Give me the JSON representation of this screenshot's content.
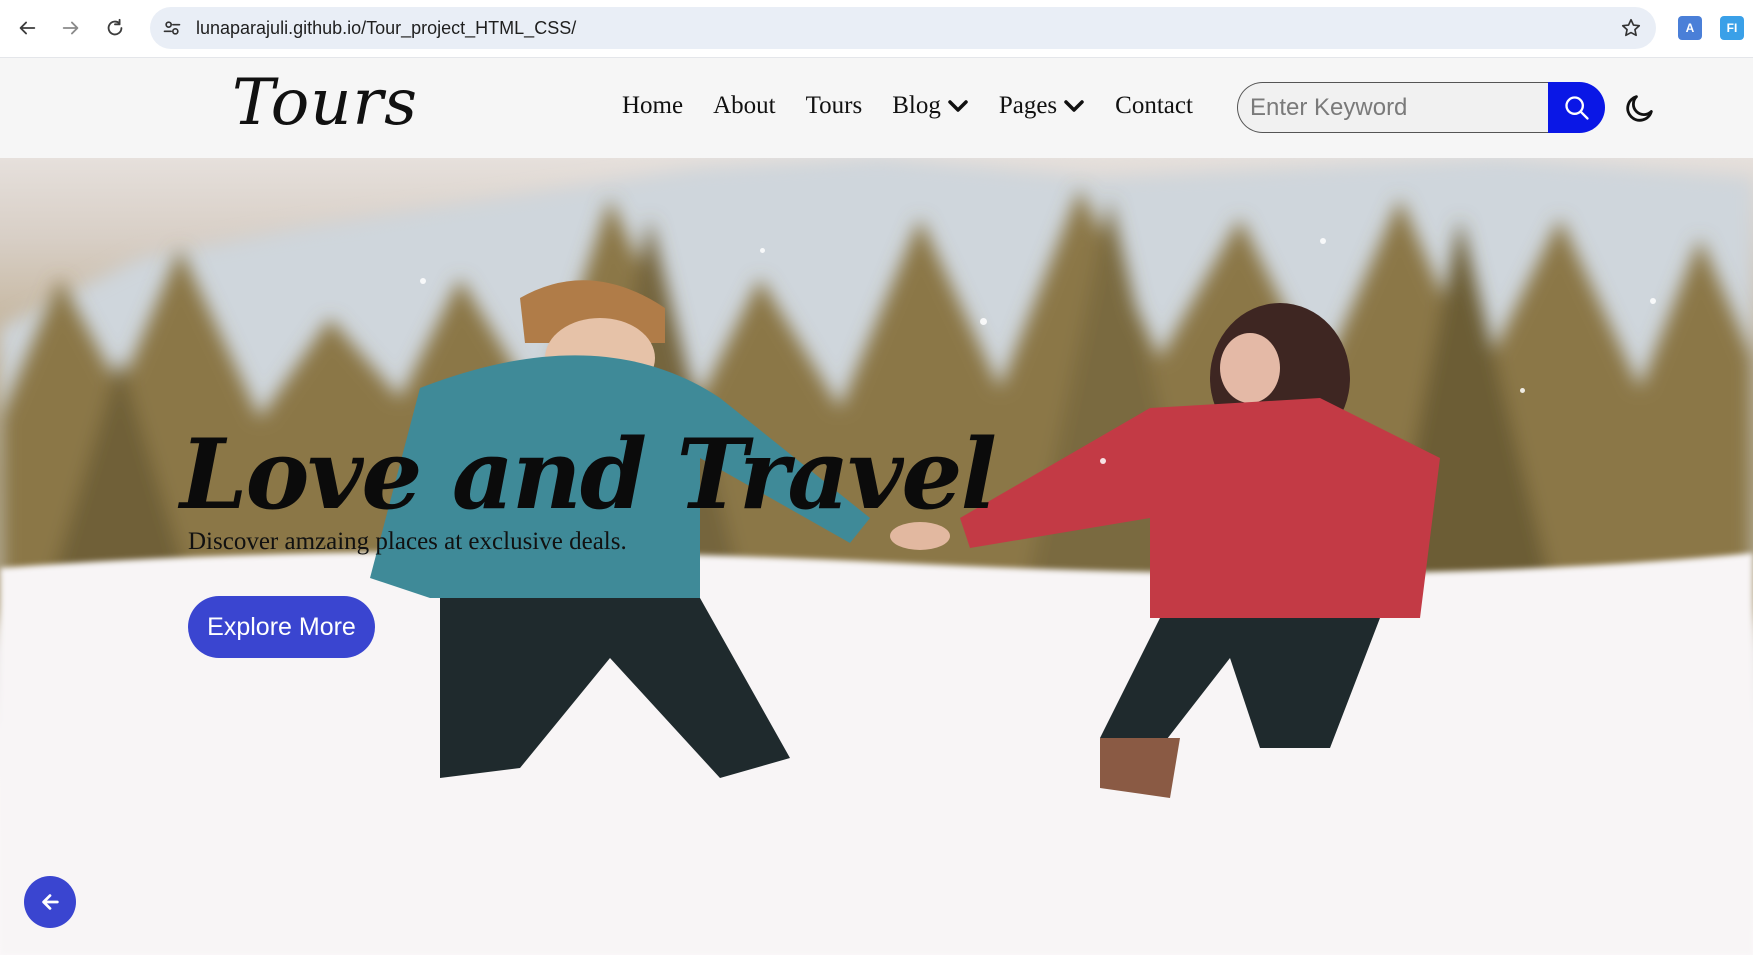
{
  "browser": {
    "url": "lunaparajuli.github.io/Tour_project_HTML_CSS/",
    "icons": [
      "back-arrow-icon",
      "forward-arrow-icon",
      "reload-icon",
      "site-settings-icon",
      "bookmark-star-icon"
    ],
    "extensions": [
      {
        "name": "translate-extension-icon",
        "label": "A",
        "color": "#4a7fd8"
      },
      {
        "name": "fi-extension-icon",
        "label": "FI",
        "color": "#3aa0e8"
      }
    ]
  },
  "navbar": {
    "logo": "Tours",
    "menu": [
      {
        "label": "Home",
        "dropdown": false
      },
      {
        "label": "About",
        "dropdown": false
      },
      {
        "label": "Tours",
        "dropdown": false
      },
      {
        "label": "Blog",
        "dropdown": true
      },
      {
        "label": "Pages",
        "dropdown": true
      },
      {
        "label": "Contact",
        "dropdown": false
      }
    ],
    "search": {
      "placeholder": "Enter Keyword"
    },
    "icons": [
      "search-icon",
      "moon-icon",
      "chevron-down-icon"
    ]
  },
  "hero": {
    "title": "Love and Travel",
    "subtitle": "Discover amzaing places at exclusive deals.",
    "cta_label": "Explore More",
    "icons": [
      "arrow-left-icon"
    ]
  },
  "colors": {
    "accent": "#3a45d0",
    "search_button": "#0a17e6",
    "navbar_bg": "#f6f6f6"
  }
}
